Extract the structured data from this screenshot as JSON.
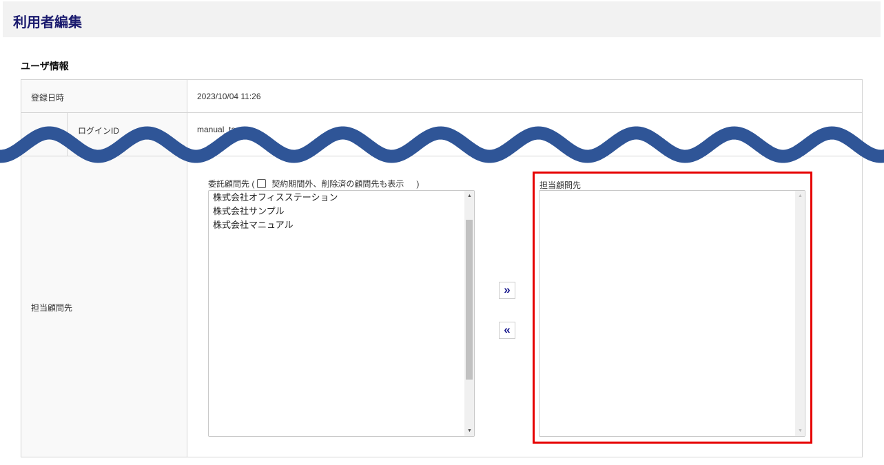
{
  "header": {
    "title": "利用者編集"
  },
  "section": {
    "title": "ユーザ情報"
  },
  "rows": {
    "registered": {
      "label": "登録日時",
      "value": "2023/10/04 11:26"
    },
    "login": {
      "label": "ログインID",
      "value": "manual_taro"
    },
    "advisor": {
      "label": "担当顧問先"
    }
  },
  "left_list": {
    "label_prefix": "委託顧問先 (",
    "checkbox_label": "契約期間外、削除済の顧問先も表示",
    "label_suffix": ")",
    "checked": false,
    "options": [
      "株式会社オフィスステーション",
      "株式会社サンプル",
      "株式会社マニュアル"
    ]
  },
  "buttons": {
    "add": "»",
    "remove": "«"
  },
  "right_list": {
    "label": "担当顧問先",
    "options": []
  },
  "colors": {
    "wave": "#2f5597",
    "highlight": "#e60000",
    "title": "#1a1a6e"
  }
}
